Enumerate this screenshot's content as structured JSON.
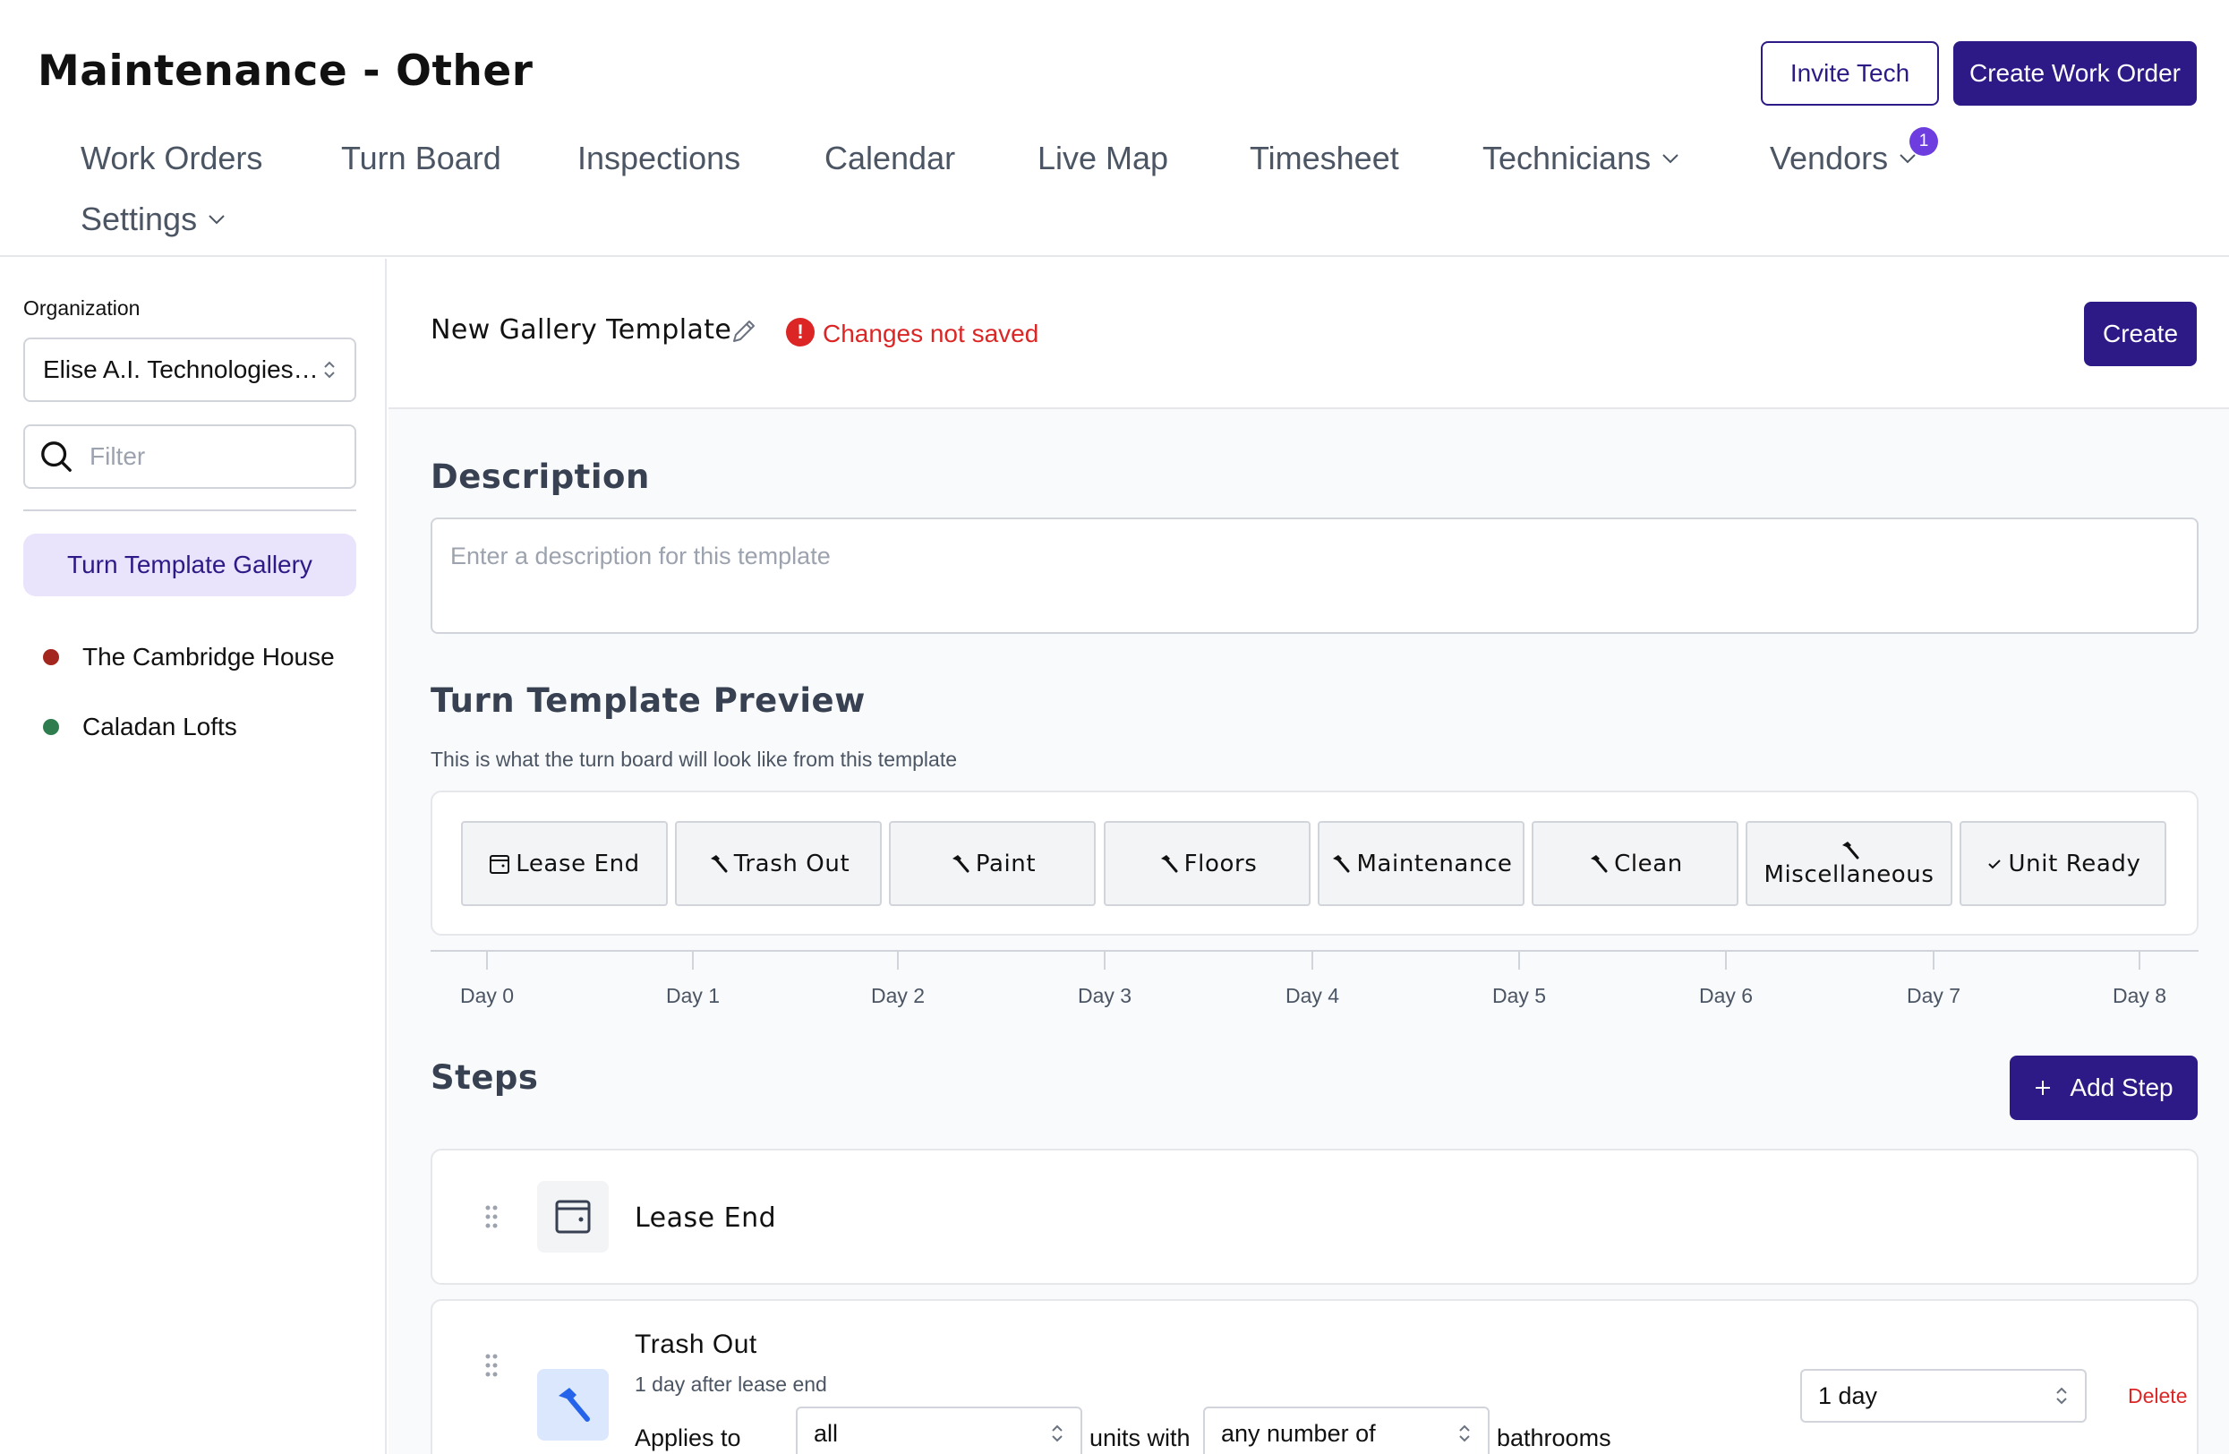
{
  "header": {
    "title": "Maintenance - Other",
    "invite_tech": "Invite Tech",
    "create_work_order": "Create Work Order",
    "nav": [
      {
        "label": "Work Orders"
      },
      {
        "label": "Turn Board"
      },
      {
        "label": "Inspections"
      },
      {
        "label": "Calendar"
      },
      {
        "label": "Live Map"
      },
      {
        "label": "Timesheet"
      },
      {
        "label": "Technicians"
      },
      {
        "label": "Vendors",
        "badge": "1"
      },
      {
        "label": "Settings"
      }
    ]
  },
  "sidebar": {
    "org_label": "Organization",
    "org_value": "Elise A.I. Technologies Corp.",
    "filter_placeholder": "Filter",
    "gallery_label": "Turn Template Gallery",
    "properties": [
      {
        "name": "The Cambridge House",
        "color": "#a3261f"
      },
      {
        "name": "Caladan Lofts",
        "color": "#2f7d4e"
      }
    ]
  },
  "main": {
    "template_name": "New Gallery Template",
    "status": "Changes not saved",
    "create_label": "Create",
    "description": {
      "title": "Description",
      "placeholder": "Enter a description for this template"
    },
    "preview": {
      "title": "Turn Template Preview",
      "subtitle": "This is what the turn board will look like from this template",
      "chips": [
        {
          "label": "Lease End",
          "icon": "calendar-icon"
        },
        {
          "label": "Trash Out",
          "icon": "hammer-icon"
        },
        {
          "label": "Paint",
          "icon": "hammer-icon"
        },
        {
          "label": "Floors",
          "icon": "hammer-icon"
        },
        {
          "label": "Maintenance",
          "icon": "hammer-icon"
        },
        {
          "label": "Clean",
          "icon": "hammer-icon"
        },
        {
          "label": "Miscellaneous",
          "icon": "hammer-icon"
        },
        {
          "label": "Unit Ready",
          "icon": "check-icon"
        }
      ],
      "days": [
        "Day 0",
        "Day 1",
        "Day 2",
        "Day 3",
        "Day 4",
        "Day 5",
        "Day 6",
        "Day 7",
        "Day 8"
      ]
    },
    "steps": {
      "title": "Steps",
      "add_label": "Add Step",
      "items": [
        {
          "title": "Lease End",
          "icon": "calendar-icon"
        },
        {
          "title": "Trash Out",
          "icon": "hammer-icon",
          "subtitle": "1 day after lease end",
          "applies_to": "Applies to",
          "applies_value": "all",
          "units_with": "units with",
          "bath_value": "any number of",
          "bathrooms": "bathrooms",
          "duration": "1 day",
          "delete": "Delete"
        }
      ]
    }
  }
}
